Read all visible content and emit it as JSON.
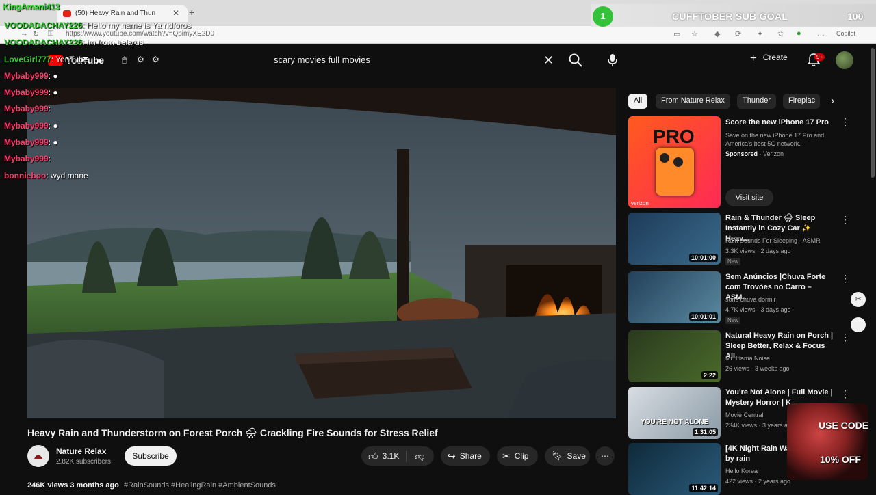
{
  "browser": {
    "tab_title": "(50) Heavy Rain and Thun",
    "url": "https://www.youtube.com/watch?v=QpimyXE2D0",
    "copilot_label": "Copilot"
  },
  "overlay": {
    "streamer": "KingAmani413",
    "goal_count": "1",
    "goal_title": "CUFFTOBER SUB GOAL",
    "goal_target": "100",
    "chat": [
      {
        "user": "VOODADACHAY226",
        "msg": ": Hello my name is Ya ridforos",
        "color": "#33cc33"
      },
      {
        "user": "VOODADACHAY226",
        "msg": ": im from belarus",
        "color": "#33cc33"
      },
      {
        "user": "LoveGirl777",
        "msg": ": YouTube",
        "color": "#33cc33"
      },
      {
        "user": "Mybaby999",
        "msg": ": ●",
        "color": "#ff3b6b"
      },
      {
        "user": "Mybaby999",
        "msg": ": ●",
        "color": "#ff3b6b"
      },
      {
        "user": "Mybaby999",
        "msg": ":",
        "color": "#ff3b6b"
      },
      {
        "user": "Mybaby999",
        "msg": ": ●",
        "color": "#ff3b6b"
      },
      {
        "user": "Mybaby999",
        "msg": ": ●",
        "color": "#ff3b6b"
      },
      {
        "user": "Mybaby999",
        "msg": ":",
        "color": "#ff3b6b"
      },
      {
        "user": "bonnieboo",
        "msg": ": wyd mane",
        "color": "#ff3b6b"
      }
    ]
  },
  "header": {
    "logo_text": "YouTube",
    "search_query": "scary movies full movies",
    "create_label": "Create",
    "notif_badge": "9+"
  },
  "chips": [
    "All",
    "From Nature Relax",
    "Thunder",
    "Fireplac"
  ],
  "video": {
    "title": "Heavy Rain and Thunderstorm on Forest Porch 🌧 Crackling Fire Sounds for Stress Relief",
    "channel": "Nature Relax",
    "subs": "2.82K subscribers",
    "subscribe_label": "Subscribe",
    "likes": "3.1K",
    "share_label": "Share",
    "clip_label": "Clip",
    "save_label": "Save",
    "views_date": "246K views  3 months ago",
    "hashtags": "#RainSounds #HealingRain #AmbientSounds"
  },
  "ad": {
    "title": "Score the new iPhone 17 Pro",
    "desc": "Save on the new iPhone 17 Pro and America's best 5G network.",
    "sponsored": "Sponsored",
    "advertiser": "Verizon",
    "thumb_label": "PRO",
    "thumb_brand": "verizon",
    "cta": "Visit site"
  },
  "sidebar": [
    {
      "title": "Rain & Thunder 🌧 Sleep Instantly in Cozy Car ✨ Heav...",
      "channel": "Rain Sounds For Sleeping - ASMR",
      "meta": "3.3K views · 2 days ago",
      "badge": "New",
      "duration": "10:01:00"
    },
    {
      "title": "Sem Anúncios |Chuva Forte com Trovões no Carro – ASM...",
      "channel": "sons chuva dormir",
      "meta": "4.7K views · 3 days ago",
      "badge": "New",
      "duration": "10:01:01"
    },
    {
      "title": "Natural Heavy Rain on Porch | Sleep Better, Relax & Focus All...",
      "channel": "Mr. Llama Noise",
      "meta": "26 views · 3 weeks ago",
      "badge": "",
      "duration": "2:22"
    },
    {
      "title": "You're Not Alone | Full Movie | Mystery Horror | K...",
      "channel": "Movie Central",
      "meta": "234K views · 3 years ago",
      "badge": "",
      "duration": "1:31:05",
      "thumb_text": "YOU'RE NOT ALONE"
    },
    {
      "title": "[4K Night Rain Wa... poem told by rain",
      "channel": "Hello Korea",
      "meta": "422 views · 2 years ago",
      "badge": "",
      "duration": "11:42:14"
    }
  ],
  "promo": {
    "line1": "USE CODE",
    "line2": "10% OFF"
  }
}
